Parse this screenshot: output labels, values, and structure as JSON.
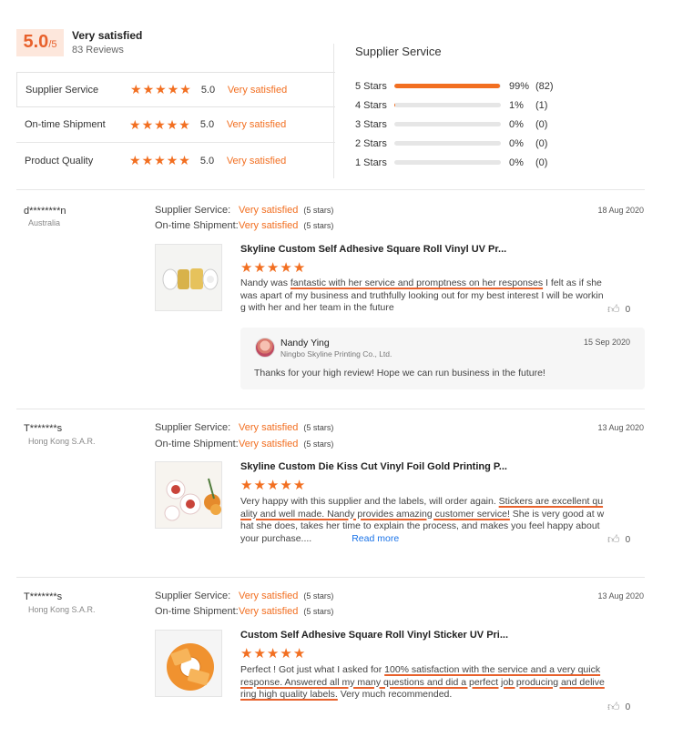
{
  "summary": {
    "score": "5.0",
    "score_max": "/5",
    "title": "Very satisfied",
    "reviews": "83 Reviews"
  },
  "ratings": [
    {
      "label": "Supplier Service",
      "stars": 5,
      "value": "5.0",
      "text": "Very satisfied"
    },
    {
      "label": "On-time Shipment",
      "stars": 5,
      "value": "5.0",
      "text": "Very satisfied"
    },
    {
      "label": "Product Quality",
      "stars": 5,
      "value": "5.0",
      "text": "Very satisfied"
    }
  ],
  "distribution": {
    "title": "Supplier Service",
    "rows": [
      {
        "label": "5 Stars",
        "fraction": 0.99,
        "pct": "99%",
        "count": "(82)"
      },
      {
        "label": "4 Stars",
        "fraction": 0.01,
        "pct": "1%",
        "count": "(1)"
      },
      {
        "label": "3 Stars",
        "fraction": 0,
        "pct": "0%",
        "count": "(0)"
      },
      {
        "label": "2 Stars",
        "fraction": 0,
        "pct": "0%",
        "count": "(0)"
      },
      {
        "label": "1 Stars",
        "fraction": 0,
        "pct": "0%",
        "count": "(0)"
      }
    ]
  },
  "meta_labels": {
    "service": "Supplier Service:",
    "shipment": "On-time Shipment:"
  },
  "colors": {
    "accent": "#f26f21",
    "link": "#1a73e8"
  },
  "reviews": [
    {
      "name": "d********n",
      "location": "Australia",
      "service": "Very satisfied",
      "service_stars": "(5 stars)",
      "shipment": "Very satisfied",
      "shipment_stars": "(5 stars)",
      "date": "18 Aug 2020",
      "product": "Skyline Custom Self Adhesive Square Roll Vinyl UV Pr...",
      "stars": 5,
      "text_a": "Nandy was ",
      "text_hl1": "fantastic with her service and promptness on her responses",
      "text_b": "  I felt as if she was apart of my business and truthfully looking out for my best interest I will be working with her and her team in the future",
      "likes": "0",
      "reply": {
        "name": "Nandy Ying",
        "company": "Ningbo Skyline Printing Co., Ltd.",
        "date": "15 Sep 2020",
        "text": "Thanks for your high review! Hope we can run business in the future!"
      }
    },
    {
      "name": "T*******s",
      "location": "Hong Kong S.A.R.",
      "service": "Very satisfied",
      "service_stars": "(5 stars)",
      "shipment": "Very satisfied",
      "shipment_stars": "(5 stars)",
      "date": "13 Aug 2020",
      "product": "Skyline Custom Die Kiss Cut Vinyl Foil Gold Printing P...",
      "stars": 5,
      "text_a": "Very happy with this supplier and the labels, will order again. ",
      "text_hl1": "Stickers are excellent quality and well made. Nandy provides amazing customer service!",
      "text_b": " She is very good at what she does, takes her time to explain the process, and makes you feel happy about your purchase....",
      "read_more": "Read more",
      "likes": "0"
    },
    {
      "name": "T*******s",
      "location": "Hong Kong S.A.R.",
      "service": "Very satisfied",
      "service_stars": "(5 stars)",
      "shipment": "Very satisfied",
      "shipment_stars": "(5 stars)",
      "date": "13 Aug 2020",
      "product": "Custom Self Adhesive Square Roll Vinyl Sticker UV Pri...",
      "stars": 5,
      "text_a": "Perfect ! Got just what I asked for ",
      "text_hl1": "100% satisfaction with the service and a very quick response. Answered all my many questions and did a perfect job producing and delivering high quality labels.",
      "text_b": " Very much recommended.",
      "likes": "0"
    }
  ]
}
